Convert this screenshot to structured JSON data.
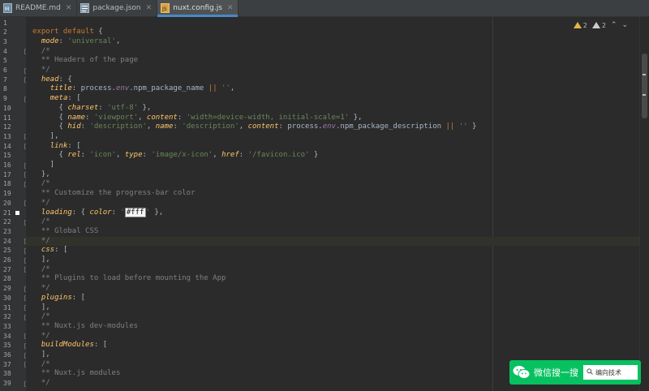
{
  "tabs": [
    {
      "label": "README.md",
      "icon": "markdown-file-icon",
      "active": false
    },
    {
      "label": "package.json",
      "icon": "json-file-icon",
      "active": false
    },
    {
      "label": "nuxt.config.js",
      "icon": "nuxt-config-file-icon",
      "active": true
    }
  ],
  "inspections": {
    "warnings": "2",
    "weak_warnings": "2"
  },
  "code_lines": [
    {
      "n": "1",
      "html": ""
    },
    {
      "n": "2",
      "html": "<span class='kw'>export default</span> {"
    },
    {
      "n": "3",
      "html": "  <span class='prop'>mode</span>: <span class='str'>'universal'</span>,"
    },
    {
      "n": "4",
      "html": "  <span class='com'>/*</span>"
    },
    {
      "n": "5",
      "html": "  <span class='com'>** Headers of the page</span>"
    },
    {
      "n": "6",
      "html": "  <span class='com'>*/</span>"
    },
    {
      "n": "7",
      "html": "  <span class='prop'>head</span>: {"
    },
    {
      "n": "8",
      "html": "    <span class='prop'>title</span>: process.<span class='var'>env</span>.npm_package_name <span class='op'>||</span> <span class='str'>''</span>,"
    },
    {
      "n": "9",
      "html": "    <span class='prop'>meta</span>: ["
    },
    {
      "n": "10",
      "html": "      { <span class='prop'>charset</span>: <span class='str'>'utf-8'</span> },"
    },
    {
      "n": "11",
      "html": "      { <span class='prop'>name</span>: <span class='str'>'viewport'</span>, <span class='prop'>content</span>: <span class='str'>'width=device-width, initial-scale=1'</span> },"
    },
    {
      "n": "12",
      "html": "      { <span class='prop'>hid</span>: <span class='str'>'description'</span>, <span class='prop'>name</span>: <span class='str'>'description'</span>, <span class='prop'>content</span>: process.<span class='var'>env</span>.npm_package_description <span class='op'>||</span> <span class='str'>''</span> }"
    },
    {
      "n": "13",
      "html": "    ],"
    },
    {
      "n": "14",
      "html": "    <span class='prop'>link</span>: ["
    },
    {
      "n": "15",
      "html": "      { <span class='prop'>rel</span>: <span class='str'>'icon'</span>, <span class='prop'>type</span>: <span class='str'>'image/x-icon'</span>, <span class='prop'>href</span>: <span class='str'>'/favicon.ico'</span> }"
    },
    {
      "n": "16",
      "html": "    ]"
    },
    {
      "n": "17",
      "html": "  },"
    },
    {
      "n": "18",
      "html": "  <span class='com'>/*</span>"
    },
    {
      "n": "19",
      "html": "  <span class='com'>** Customize the progress-bar color</span>"
    },
    {
      "n": "20",
      "html": "  <span class='com'>*/</span>"
    },
    {
      "n": "21",
      "html": "  <span class='prop'>loading</span>: { <span class='prop'>color</span>: <span class='str'>'</span><span class='hl'>#fff</span><span class='str'>'</span> },"
    },
    {
      "n": "22",
      "html": "  <span class='com'>/*</span>"
    },
    {
      "n": "23",
      "html": "  <span class='com'>** Global CSS</span>"
    },
    {
      "n": "24",
      "html": "  <span class='com'>*/</span>"
    },
    {
      "n": "25",
      "html": "  <span class='prop'>css</span>: ["
    },
    {
      "n": "26",
      "html": "  ],"
    },
    {
      "n": "27",
      "html": "  <span class='com'>/*</span>"
    },
    {
      "n": "28",
      "html": "  <span class='com'>** Plugins to load before mounting the App</span>"
    },
    {
      "n": "29",
      "html": "  <span class='com'>*/</span>"
    },
    {
      "n": "30",
      "html": "  <span class='prop'>plugins</span>: ["
    },
    {
      "n": "31",
      "html": "  ],"
    },
    {
      "n": "32",
      "html": "  <span class='com'>/*</span>"
    },
    {
      "n": "33",
      "html": "  <span class='com'>** Nuxt.js dev-modules</span>"
    },
    {
      "n": "34",
      "html": "  <span class='com'>*/</span>"
    },
    {
      "n": "35",
      "html": "  <span class='prop'>buildModules</span>: ["
    },
    {
      "n": "36",
      "html": "  ],"
    },
    {
      "n": "37",
      "html": "  <span class='com'>/*</span>"
    },
    {
      "n": "38",
      "html": "  <span class='com'>** Nuxt.js modules</span>"
    },
    {
      "n": "39",
      "html": "  <span class='com'>*/</span>"
    }
  ],
  "current_line": "24",
  "bookmark_line": "21",
  "watermark": {
    "text": "微信搜一搜",
    "search_text": "编向技术"
  },
  "colors": {
    "keyword": "#cc7832",
    "property": "#ffc66d",
    "string": "#6a8759",
    "comment": "#808080",
    "accent": "#4a88c7",
    "watermark_bg": "#07c160"
  }
}
